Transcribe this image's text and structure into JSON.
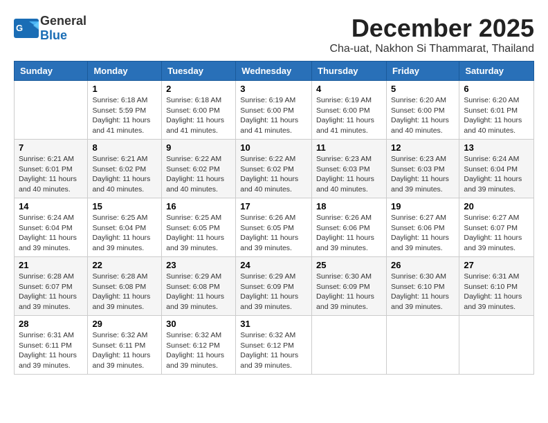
{
  "app": {
    "logo_general": "General",
    "logo_blue": "Blue"
  },
  "header": {
    "month": "December 2025",
    "location": "Cha-uat, Nakhon Si Thammarat, Thailand"
  },
  "weekdays": [
    "Sunday",
    "Monday",
    "Tuesday",
    "Wednesday",
    "Thursday",
    "Friday",
    "Saturday"
  ],
  "weeks": [
    [
      {
        "day": "",
        "info": ""
      },
      {
        "day": "1",
        "info": "Sunrise: 6:18 AM\nSunset: 5:59 PM\nDaylight: 11 hours\nand 41 minutes."
      },
      {
        "day": "2",
        "info": "Sunrise: 6:18 AM\nSunset: 6:00 PM\nDaylight: 11 hours\nand 41 minutes."
      },
      {
        "day": "3",
        "info": "Sunrise: 6:19 AM\nSunset: 6:00 PM\nDaylight: 11 hours\nand 41 minutes."
      },
      {
        "day": "4",
        "info": "Sunrise: 6:19 AM\nSunset: 6:00 PM\nDaylight: 11 hours\nand 41 minutes."
      },
      {
        "day": "5",
        "info": "Sunrise: 6:20 AM\nSunset: 6:00 PM\nDaylight: 11 hours\nand 40 minutes."
      },
      {
        "day": "6",
        "info": "Sunrise: 6:20 AM\nSunset: 6:01 PM\nDaylight: 11 hours\nand 40 minutes."
      }
    ],
    [
      {
        "day": "7",
        "info": "Sunrise: 6:21 AM\nSunset: 6:01 PM\nDaylight: 11 hours\nand 40 minutes."
      },
      {
        "day": "8",
        "info": "Sunrise: 6:21 AM\nSunset: 6:02 PM\nDaylight: 11 hours\nand 40 minutes."
      },
      {
        "day": "9",
        "info": "Sunrise: 6:22 AM\nSunset: 6:02 PM\nDaylight: 11 hours\nand 40 minutes."
      },
      {
        "day": "10",
        "info": "Sunrise: 6:22 AM\nSunset: 6:02 PM\nDaylight: 11 hours\nand 40 minutes."
      },
      {
        "day": "11",
        "info": "Sunrise: 6:23 AM\nSunset: 6:03 PM\nDaylight: 11 hours\nand 40 minutes."
      },
      {
        "day": "12",
        "info": "Sunrise: 6:23 AM\nSunset: 6:03 PM\nDaylight: 11 hours\nand 39 minutes."
      },
      {
        "day": "13",
        "info": "Sunrise: 6:24 AM\nSunset: 6:04 PM\nDaylight: 11 hours\nand 39 minutes."
      }
    ],
    [
      {
        "day": "14",
        "info": "Sunrise: 6:24 AM\nSunset: 6:04 PM\nDaylight: 11 hours\nand 39 minutes."
      },
      {
        "day": "15",
        "info": "Sunrise: 6:25 AM\nSunset: 6:04 PM\nDaylight: 11 hours\nand 39 minutes."
      },
      {
        "day": "16",
        "info": "Sunrise: 6:25 AM\nSunset: 6:05 PM\nDaylight: 11 hours\nand 39 minutes."
      },
      {
        "day": "17",
        "info": "Sunrise: 6:26 AM\nSunset: 6:05 PM\nDaylight: 11 hours\nand 39 minutes."
      },
      {
        "day": "18",
        "info": "Sunrise: 6:26 AM\nSunset: 6:06 PM\nDaylight: 11 hours\nand 39 minutes."
      },
      {
        "day": "19",
        "info": "Sunrise: 6:27 AM\nSunset: 6:06 PM\nDaylight: 11 hours\nand 39 minutes."
      },
      {
        "day": "20",
        "info": "Sunrise: 6:27 AM\nSunset: 6:07 PM\nDaylight: 11 hours\nand 39 minutes."
      }
    ],
    [
      {
        "day": "21",
        "info": "Sunrise: 6:28 AM\nSunset: 6:07 PM\nDaylight: 11 hours\nand 39 minutes."
      },
      {
        "day": "22",
        "info": "Sunrise: 6:28 AM\nSunset: 6:08 PM\nDaylight: 11 hours\nand 39 minutes."
      },
      {
        "day": "23",
        "info": "Sunrise: 6:29 AM\nSunset: 6:08 PM\nDaylight: 11 hours\nand 39 minutes."
      },
      {
        "day": "24",
        "info": "Sunrise: 6:29 AM\nSunset: 6:09 PM\nDaylight: 11 hours\nand 39 minutes."
      },
      {
        "day": "25",
        "info": "Sunrise: 6:30 AM\nSunset: 6:09 PM\nDaylight: 11 hours\nand 39 minutes."
      },
      {
        "day": "26",
        "info": "Sunrise: 6:30 AM\nSunset: 6:10 PM\nDaylight: 11 hours\nand 39 minutes."
      },
      {
        "day": "27",
        "info": "Sunrise: 6:31 AM\nSunset: 6:10 PM\nDaylight: 11 hours\nand 39 minutes."
      }
    ],
    [
      {
        "day": "28",
        "info": "Sunrise: 6:31 AM\nSunset: 6:11 PM\nDaylight: 11 hours\nand 39 minutes."
      },
      {
        "day": "29",
        "info": "Sunrise: 6:32 AM\nSunset: 6:11 PM\nDaylight: 11 hours\nand 39 minutes."
      },
      {
        "day": "30",
        "info": "Sunrise: 6:32 AM\nSunset: 6:12 PM\nDaylight: 11 hours\nand 39 minutes."
      },
      {
        "day": "31",
        "info": "Sunrise: 6:32 AM\nSunset: 6:12 PM\nDaylight: 11 hours\nand 39 minutes."
      },
      {
        "day": "",
        "info": ""
      },
      {
        "day": "",
        "info": ""
      },
      {
        "day": "",
        "info": ""
      }
    ]
  ]
}
